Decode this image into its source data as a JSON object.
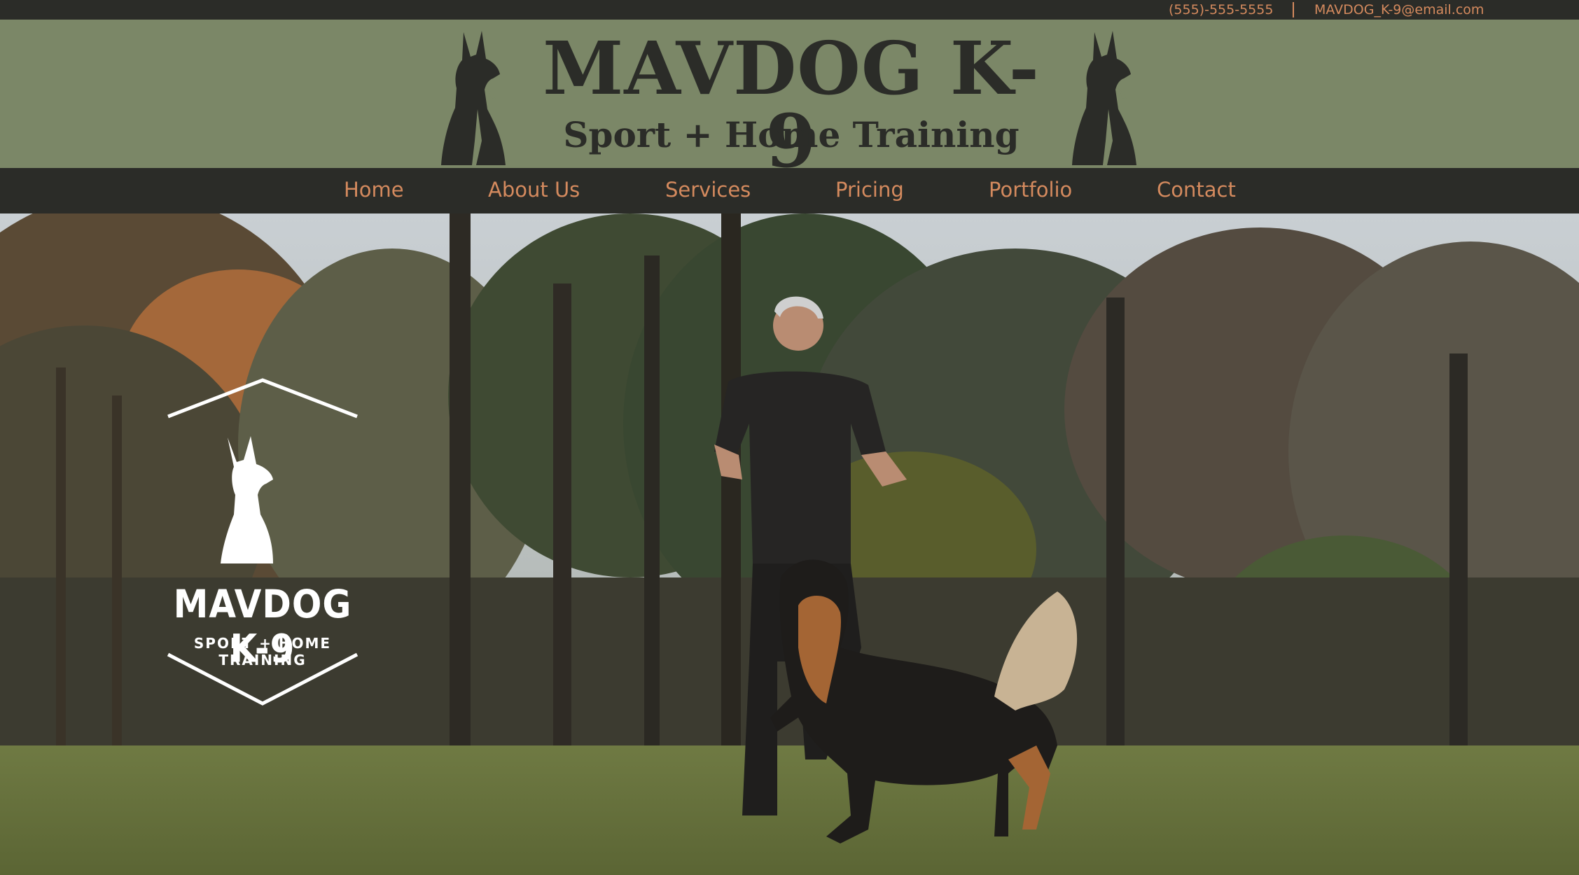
{
  "contact": {
    "phone": "(555)-555-5555",
    "email": "MAVDOG_K-9@email.com"
  },
  "header": {
    "title": "MAVDOG K-9",
    "subtitle": "Sport + Home Training",
    "mascot_icon": "doberman-icon"
  },
  "nav": {
    "items": [
      {
        "label": "Home"
      },
      {
        "label": "About Us"
      },
      {
        "label": "Services"
      },
      {
        "label": "Pricing"
      },
      {
        "label": "Portfolio"
      },
      {
        "label": "Contact"
      }
    ]
  },
  "hero": {
    "logo_title": "MAVDOG K-9",
    "logo_subtitle": "SPORT + HOME TRAINING"
  },
  "colors": {
    "dark": "#2b2c28",
    "olive": "#7b8767",
    "accent": "#d48a5e"
  }
}
